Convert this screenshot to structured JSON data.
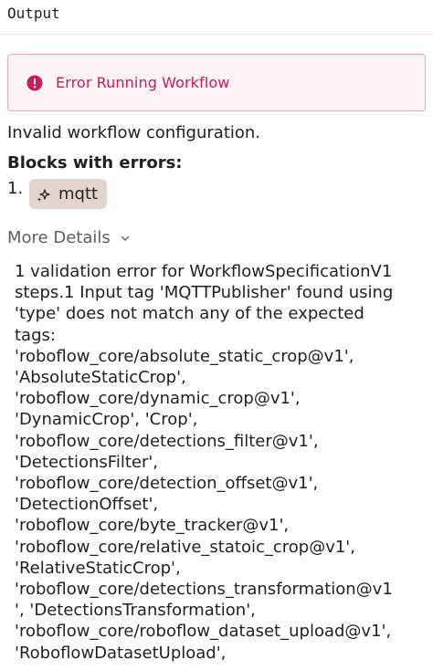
{
  "header": {
    "title": "Output"
  },
  "alert": {
    "icon": "exclamation-circle-icon",
    "title": "Error Running Workflow",
    "color": "#c21f5b"
  },
  "error": {
    "message": "Invalid workflow configuration.",
    "blocks_title": "Blocks with errors:",
    "blocks": [
      {
        "number": "1.",
        "icon": "sparkle-icon",
        "label": "mqtt"
      }
    ]
  },
  "more_details": {
    "label": "More Details",
    "icon": "chevron-down-icon"
  },
  "details": {
    "lines": [
      "1 validation error for WorkflowSpecificationV1",
      "steps.1 Input tag 'MQTTPublisher' found using",
      "'type' does not match any of the expected",
      "tags:",
      "'roboflow_core/absolute_static_crop@v1',",
      "'AbsoluteStaticCrop',",
      "'roboflow_core/dynamic_crop@v1',",
      "'DynamicCrop', 'Crop',",
      "'roboflow_core/detections_filter@v1',",
      "'DetectionsFilter',",
      "'roboflow_core/detection_offset@v1',",
      "'DetectionOffset',",
      "'roboflow_core/byte_tracker@v1',",
      "'roboflow_core/relative_statoic_crop@v1',",
      "'RelativeStaticCrop',",
      "'roboflow_core/detections_transformation@v1",
      "', 'DetectionsTransformation',",
      "'roboflow_core/roboflow_dataset_upload@v1',",
      "'RoboflowDatasetUpload',"
    ]
  }
}
